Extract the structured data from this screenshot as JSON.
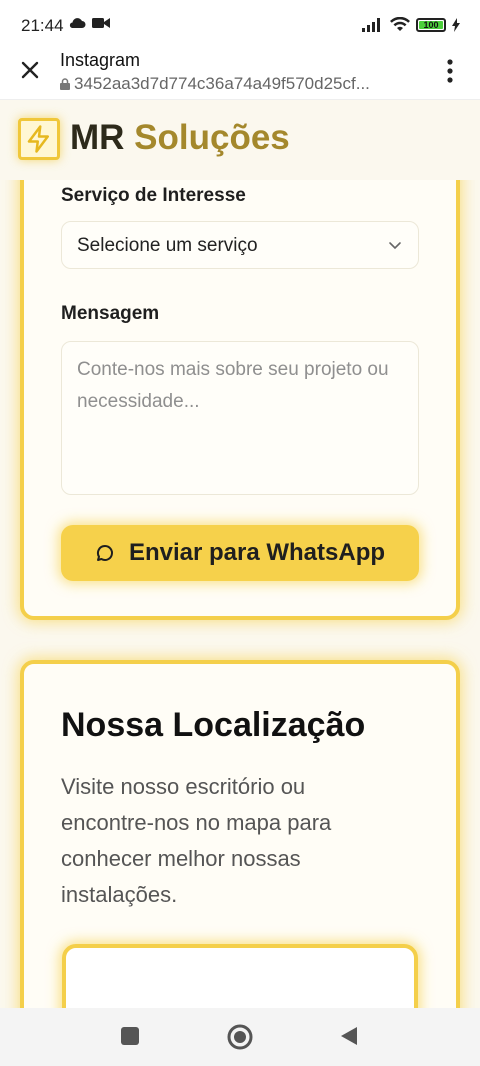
{
  "status_bar": {
    "time": "21:44",
    "battery": "100",
    "battery_color": "#4ccf3b"
  },
  "browser": {
    "title": "Instagram",
    "url": "3452aa3d7d774c36a74a49f570d25cf..."
  },
  "header": {
    "brand_first": "MR",
    "brand_second": "Soluções"
  },
  "form": {
    "service_label": "Serviço de Interesse",
    "service_value": "Selecione um serviço",
    "message_label": "Mensagem",
    "message_placeholder": "Conte-nos mais sobre seu projeto ou necessidade...",
    "submit_label": "Enviar para WhatsApp"
  },
  "location": {
    "title": "Nossa Localização",
    "description": "Visite nosso escritório ou encontre-nos no mapa para conhecer melhor nossas instalações."
  },
  "colors": {
    "accent": "#f4cf4a",
    "button": "#f6d14b",
    "background": "#fbf8ee"
  },
  "icons": [
    "cloud-icon",
    "video-icon",
    "signal-icon",
    "wifi-icon",
    "battery-icon",
    "charging-icon",
    "close-icon",
    "more-vert-icon",
    "lock-icon",
    "lightning-icon",
    "chevron-down-icon",
    "chat-icon",
    "nav-recents-icon",
    "nav-home-icon",
    "nav-back-icon"
  ]
}
